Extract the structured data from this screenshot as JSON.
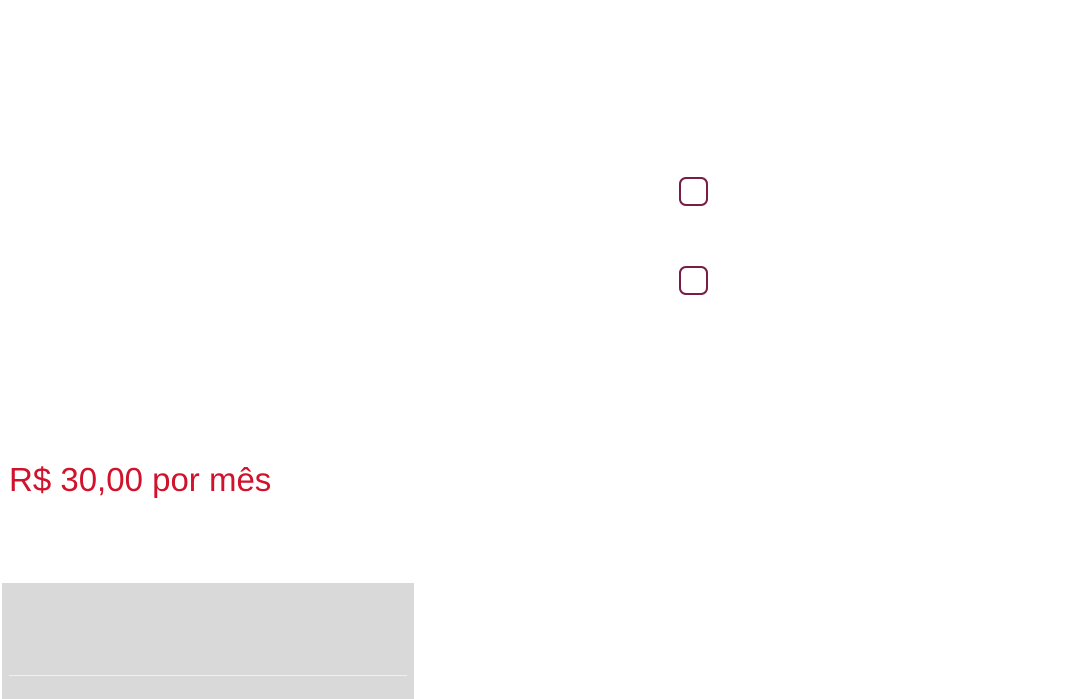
{
  "price": {
    "label": "R$ 30,00 por mês"
  },
  "options": {
    "items": [
      {
        "label": "",
        "checked": false
      },
      {
        "label": "",
        "checked": false
      }
    ]
  },
  "colors": {
    "price": "#d0122c",
    "checkbox_border": "#7a1c45",
    "panel_gray": "#d9d9d9"
  }
}
